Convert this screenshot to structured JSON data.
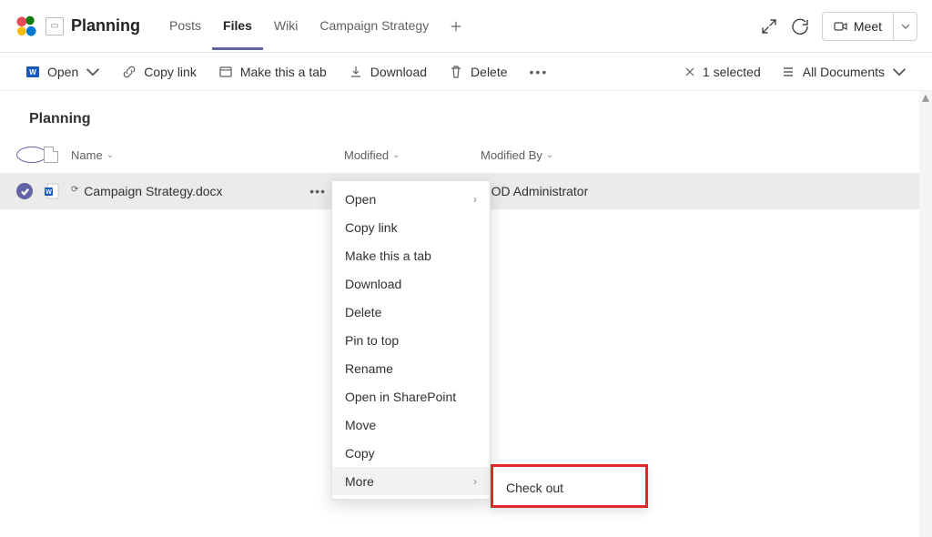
{
  "header": {
    "channel": "Planning",
    "tabs": [
      "Posts",
      "Files",
      "Wiki",
      "Campaign Strategy"
    ],
    "active_tab_index": 1,
    "meet_label": "Meet"
  },
  "cmdbar": {
    "open": "Open",
    "copy_link": "Copy link",
    "make_tab": "Make this a tab",
    "download": "Download",
    "delete": "Delete",
    "selected": "1 selected",
    "view": "All Documents"
  },
  "library": {
    "title": "Planning",
    "columns": {
      "name": "Name",
      "modified": "Modified",
      "modified_by": "Modified By"
    },
    "file": {
      "name": "Campaign Strategy.docx",
      "modified_by": "MOD Administrator"
    }
  },
  "context_menu": [
    "Open",
    "Copy link",
    "Make this a tab",
    "Download",
    "Delete",
    "Pin to top",
    "Rename",
    "Open in SharePoint",
    "Move",
    "Copy",
    "More"
  ],
  "submenu": {
    "check_out": "Check out"
  }
}
